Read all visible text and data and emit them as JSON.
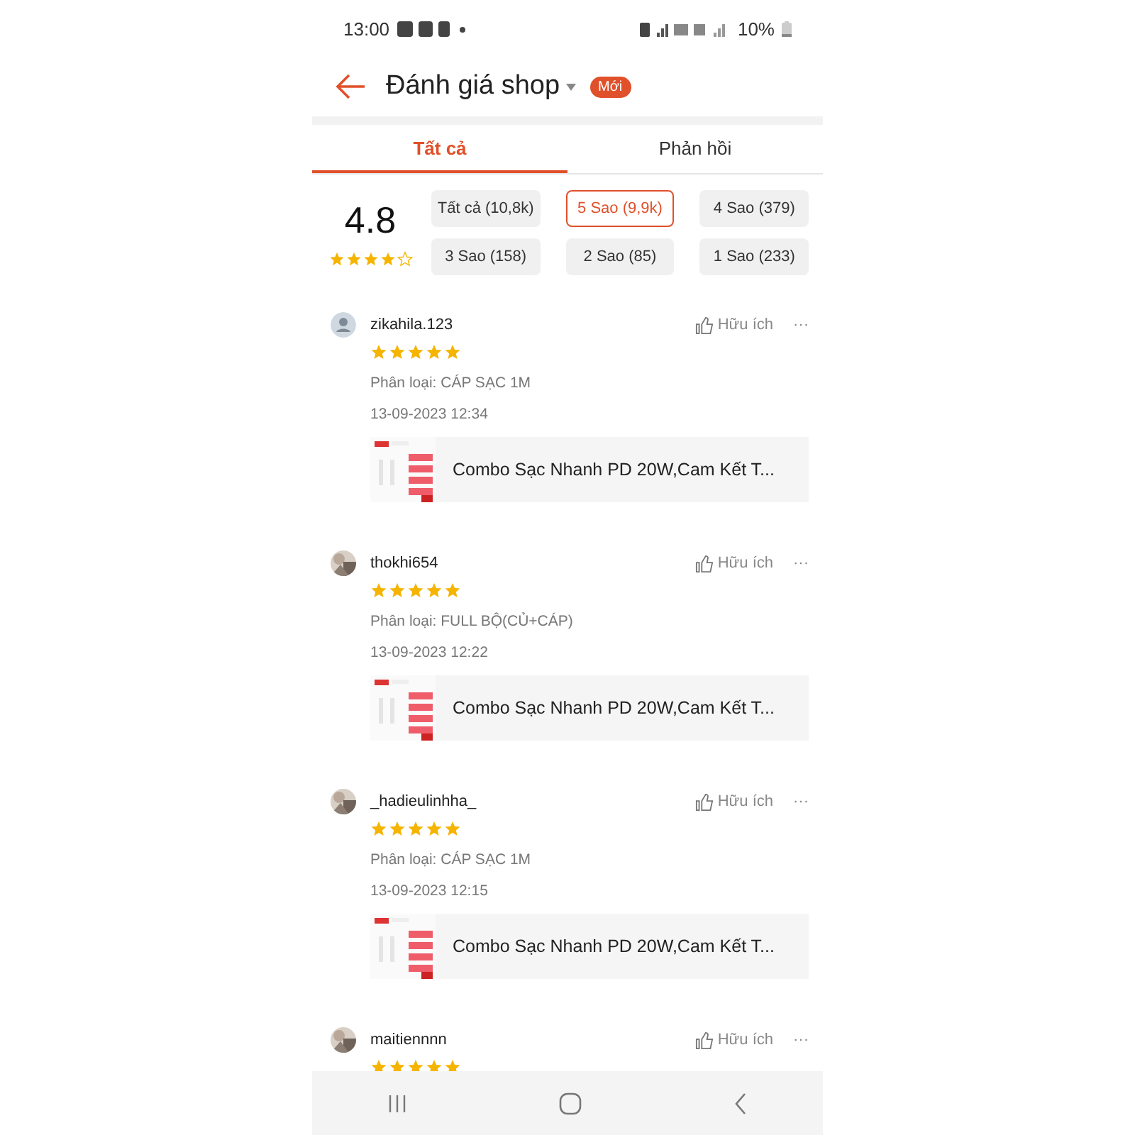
{
  "status_bar": {
    "time": "13:00",
    "battery": "10%"
  },
  "header": {
    "title": "Đánh giá shop",
    "badge": "Mới"
  },
  "tabs": [
    {
      "label": "Tất cả",
      "selected": true
    },
    {
      "label": "Phản hồi",
      "selected": false
    }
  ],
  "summary": {
    "score": "4.8",
    "stars": 4
  },
  "filters": [
    {
      "label": "Tất cả (10,8k)",
      "selected": false
    },
    {
      "label": "5 Sao (9,9k)",
      "selected": true
    },
    {
      "label": "4 Sao (379)",
      "selected": false
    },
    {
      "label": "3 Sao (158)",
      "selected": false
    },
    {
      "label": "2 Sao (85)",
      "selected": false
    },
    {
      "label": "1 Sao (233)",
      "selected": false
    }
  ],
  "reviews": [
    {
      "user": "zikahila.123",
      "kind": "placeholder",
      "stars": 5,
      "helpful": "Hữu ích",
      "menu": "···",
      "variation": "Phân loại: CÁP SẠC 1M",
      "date": "13-09-2023 12:34",
      "product": "Combo Sạc Nhanh PD 20W,Cam Kết T..."
    },
    {
      "user": "thokhi654",
      "stars": 5,
      "helpful": "Hữu ích",
      "menu": "···",
      "variation": "Phân loại: FULL BỘ(CỦ+CÁP)",
      "date": "13-09-2023 12:22",
      "product": "Combo Sạc Nhanh PD 20W,Cam Kết T..."
    },
    {
      "user": "_hadieulinhha_",
      "stars": 5,
      "helpful": "Hữu ích",
      "menu": "···",
      "variation": "Phân loại: CÁP SẠC 1M",
      "date": "13-09-2023 12:15",
      "product": "Combo Sạc Nhanh PD 20W,Cam Kết T..."
    },
    {
      "user": "maitiennnn",
      "stars": 5,
      "helpful": "Hữu ích",
      "menu": "···"
    }
  ]
}
